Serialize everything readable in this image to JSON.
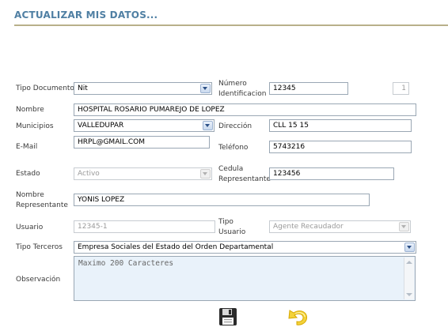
{
  "header": {
    "title": "ACTUALIZAR MIS DATOS..."
  },
  "form": {
    "tipo_documento": {
      "label": "Tipo Documento",
      "value": "Nit"
    },
    "numero_identificacion": {
      "label_line1": "Número",
      "label_line2": "Identificacion",
      "value": "12345",
      "dv": "1"
    },
    "nombre": {
      "label": "Nombre",
      "value": "HOSPITAL ROSARIO PUMAREJO DE LOPEZ"
    },
    "municipios": {
      "label": "Municipios",
      "value": "VALLEDUPAR"
    },
    "direccion": {
      "label": "Dirección",
      "value": "CLL 15 15"
    },
    "email": {
      "label": "E-Mail",
      "value": "HRPL@GMAIL.COM"
    },
    "telefono": {
      "label": "Teléfono",
      "value": "5743216"
    },
    "estado": {
      "label": "Estado",
      "value": "Activo"
    },
    "cedula_representante": {
      "label_line1": "Cedula",
      "label_line2": "Representante",
      "value": "123456"
    },
    "nombre_representante": {
      "label_line1": "Nombre",
      "label_line2": "Representante",
      "value": "YONIS  LOPEZ"
    },
    "usuario": {
      "label": "Usuario",
      "value": "12345-1"
    },
    "tipo_usuario": {
      "label_line1": "Tipo",
      "label_line2": "Usuario",
      "value": "Agente Recaudador"
    },
    "tipo_terceros": {
      "label": "Tipo Terceros",
      "value": "Empresa Sociales del Estado del Orden Departamental"
    },
    "observacion": {
      "label": "Observación",
      "placeholder": "Maximo 200 Caracteres"
    }
  },
  "actions": {
    "save_icon": "floppy-disk-icon",
    "back_icon": "yellow-return-arrow-icon"
  },
  "colors": {
    "title": "#4f7fa3",
    "title_rule": "#b8b08a",
    "textarea_bg": "#e9f2fa",
    "field_border": "#9aa7b4"
  }
}
